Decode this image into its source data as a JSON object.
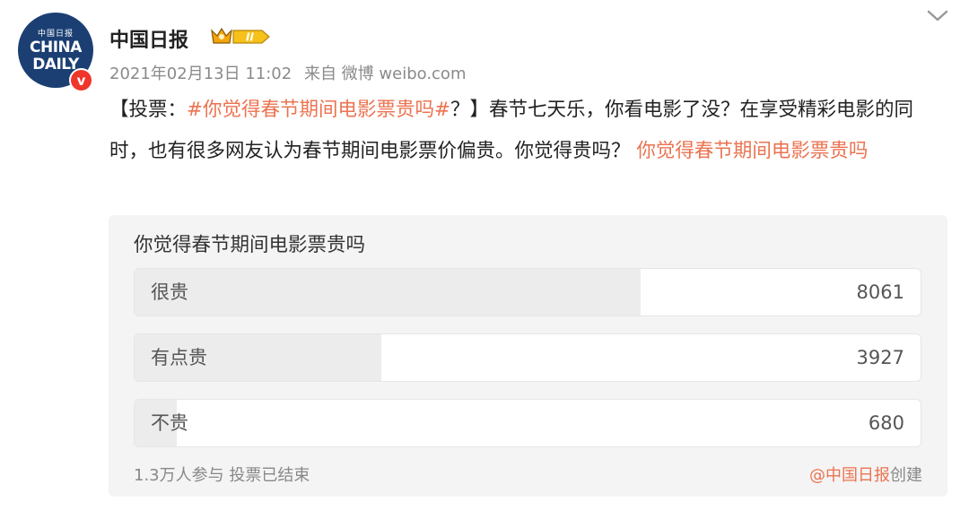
{
  "avatar": {
    "top_text": "中国日报",
    "line1": "CHINA",
    "line2": "DAILY",
    "badge": "v",
    "colors": {
      "background": "#1b3f73",
      "badge": "#f0352a"
    }
  },
  "header": {
    "username": "中国日报",
    "membership_badge": "crown-vip-level-II",
    "timestamp": "2021年02月13日 11:02",
    "source": "来自 微博 weibo.com"
  },
  "post": {
    "parts": [
      {
        "text": "【投票：",
        "hashtag": false
      },
      {
        "text": "#你觉得春节期间电影票贵吗#",
        "hashtag": true
      },
      {
        "text": "？】春节七天乐，你看电影了没？在享受精彩电影的同时，也有很多网友认为春节期间电影票价偏贵。你觉得贵吗？ ",
        "hashtag": false
      },
      {
        "text": "你觉得春节期间电影票贵吗",
        "hashtag": true
      }
    ],
    "hashtag_color": "#eb7350"
  },
  "poll": {
    "title": "你觉得春节期间电影票贵吗",
    "options": [
      {
        "label": "很贵",
        "count": "8061",
        "share": 0.644
      },
      {
        "label": "有点贵",
        "count": "3927",
        "share": 0.314
      },
      {
        "label": "不贵",
        "count": "680",
        "share": 0.054
      }
    ],
    "participants": "1.3万人参与",
    "status": "投票已结束",
    "creator_handle": "@中国日报",
    "creator_suffix": "创建"
  }
}
